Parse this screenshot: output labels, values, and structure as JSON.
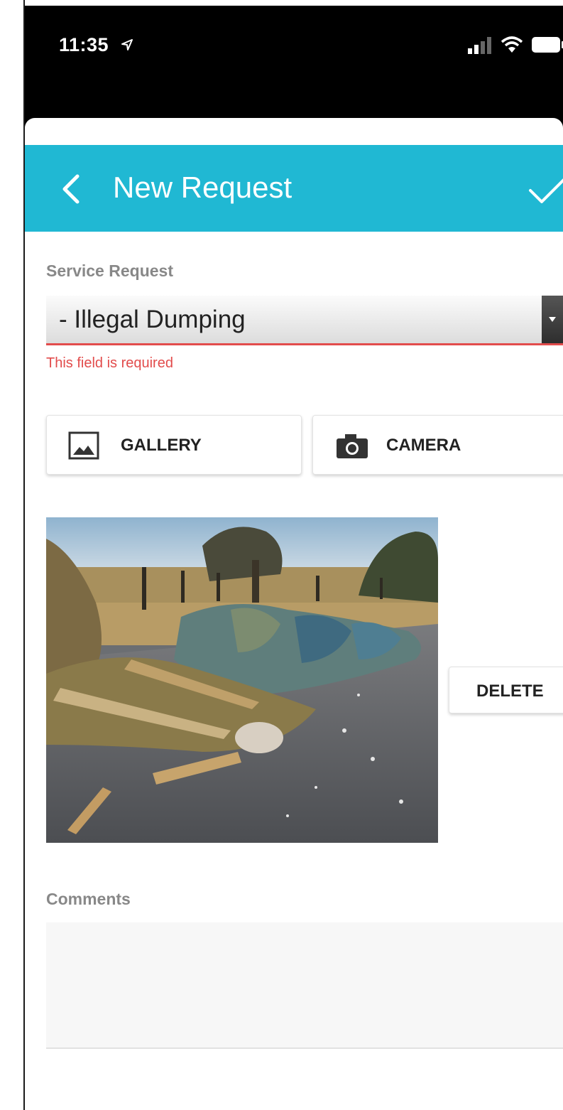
{
  "status_bar": {
    "time": "11:35",
    "icons": [
      "location-arrow-icon",
      "signal-icon",
      "wifi-icon",
      "battery-icon"
    ]
  },
  "header": {
    "title": "New Request",
    "back_icon": "chevron-left-icon",
    "confirm_icon": "check-icon",
    "bg_color": "#20b8d3"
  },
  "service_request": {
    "label": "Service Request",
    "selected_value": "- Illegal Dumping",
    "error": "This field is required",
    "error_color": "#e24c4c"
  },
  "media_buttons": {
    "gallery_label": "GALLERY",
    "camera_label": "CAMERA"
  },
  "attachment": {
    "delete_label": "DELETE"
  },
  "comments": {
    "label": "Comments",
    "value": ""
  }
}
